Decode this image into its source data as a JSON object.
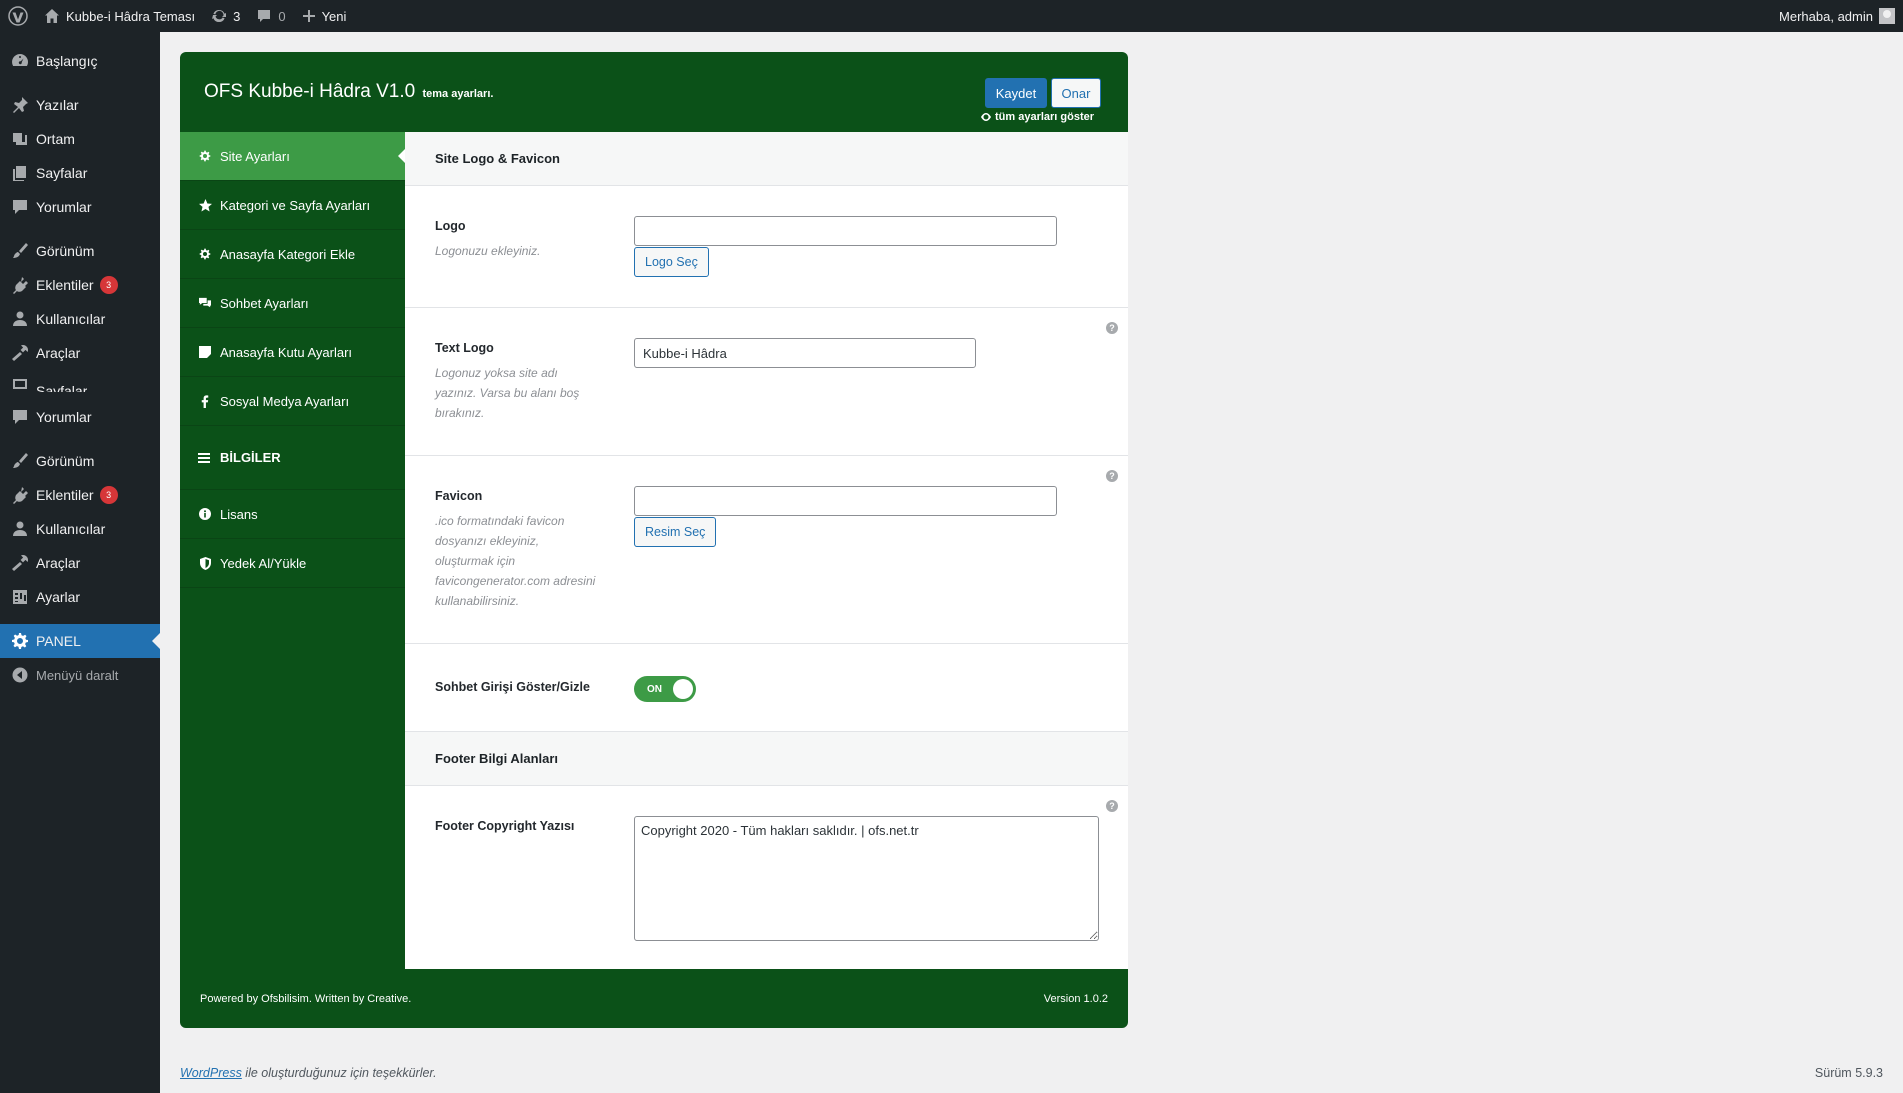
{
  "adminbar": {
    "site_name": "Kubbe-i Hâdra Teması",
    "updates_count": "3",
    "comments_count": "0",
    "new_label": "Yeni",
    "greeting": "Merhaba, admin"
  },
  "sidebar": {
    "items": [
      {
        "label": "Başlangıç",
        "icon": "dashboard-icon"
      },
      {
        "label": "Yazılar",
        "icon": "pin-icon"
      },
      {
        "label": "Ortam",
        "icon": "media-icon"
      },
      {
        "label": "Sayfalar",
        "icon": "pages-icon"
      },
      {
        "label": "Yorumlar",
        "icon": "comment-icon"
      },
      {
        "label": "Görünüm",
        "icon": "brush-icon"
      },
      {
        "label": "Eklentiler",
        "icon": "plugin-icon",
        "badge": "3"
      },
      {
        "label": "Kullanıcılar",
        "icon": "user-icon"
      },
      {
        "label": "Araçlar",
        "icon": "wrench-icon"
      },
      {
        "label": "Sayfalar",
        "icon": "pages-icon"
      },
      {
        "label": "Yorumlar",
        "icon": "comment-icon"
      },
      {
        "label": "Görünüm",
        "icon": "brush-icon"
      },
      {
        "label": "Eklentiler",
        "icon": "plugin-icon",
        "badge": "3"
      },
      {
        "label": "Kullanıcılar",
        "icon": "user-icon"
      },
      {
        "label": "Araçlar",
        "icon": "wrench-icon"
      },
      {
        "label": "Ayarlar",
        "icon": "settings-icon"
      },
      {
        "label": "PANEL",
        "icon": "gear-icon"
      },
      {
        "label": "Menüyü daralt",
        "icon": "collapse-icon"
      }
    ]
  },
  "panel": {
    "title": "OFS Kubbe-i Hâdra V1.0",
    "subtitle": "tema ayarları.",
    "save_label": "Kaydet",
    "reset_label": "Onar",
    "show_all_label": "tüm ayarları göster",
    "nav": [
      {
        "label": "Site Ayarları",
        "icon": "gear-icon"
      },
      {
        "label": "Kategori ve Sayfa Ayarları",
        "icon": "star-icon"
      },
      {
        "label": "Anasayfa Kategori Ekle",
        "icon": "gear-icon"
      },
      {
        "label": "Sohbet Ayarları",
        "icon": "comments-icon"
      },
      {
        "label": "Anasayfa Kutu Ayarları",
        "icon": "note-icon"
      },
      {
        "label": "Sosyal Medya Ayarları",
        "icon": "facebook-icon"
      }
    ],
    "info_heading": "BİLGİLER",
    "info_nav": [
      {
        "label": "Lisans",
        "icon": "info-icon"
      },
      {
        "label": "Yedek Al/Yükle",
        "icon": "shield-icon"
      }
    ],
    "section1_title": "Site Logo & Favicon",
    "logo": {
      "label": "Logo",
      "desc": "Logonuzu ekleyiniz.",
      "value": "",
      "button": "Logo Seç"
    },
    "text_logo": {
      "label": "Text Logo",
      "desc": "Logonuz yoksa site adı yazınız. Varsa bu alanı boş bırakınız.",
      "value": "Kubbe-i Hâdra"
    },
    "favicon": {
      "label": "Favicon",
      "desc": ".ico formatındaki favicon dosyanızı ekleyiniz, oluşturmak için favicongenerator.com adresini kullanabilirsiniz.",
      "value": "",
      "button": "Resim Seç"
    },
    "chat_toggle": {
      "label": "Sohbet Girişi Göster/Gizle",
      "state": "ON"
    },
    "section2_title": "Footer Bilgi Alanları",
    "footer_copyright": {
      "label": "Footer Copyright Yazısı",
      "value": "Copyright 2020 - Tüm hakları saklıdır. | ofs.net.tr"
    },
    "help_glyph": "?",
    "footer_left": "Powered by Ofsbilisim. Written by Creative.",
    "footer_right": "Version 1.0.2"
  },
  "wpfooter": {
    "link": "WordPress",
    "thanks": " ile oluşturduğunuz için teşekkürler.",
    "version": "Sürüm 5.9.3"
  },
  "colors": {
    "panel_green": "#0b5118",
    "active_green": "#3d9b46",
    "wp_blue": "#2271b1",
    "adminbar": "#1d2327"
  }
}
